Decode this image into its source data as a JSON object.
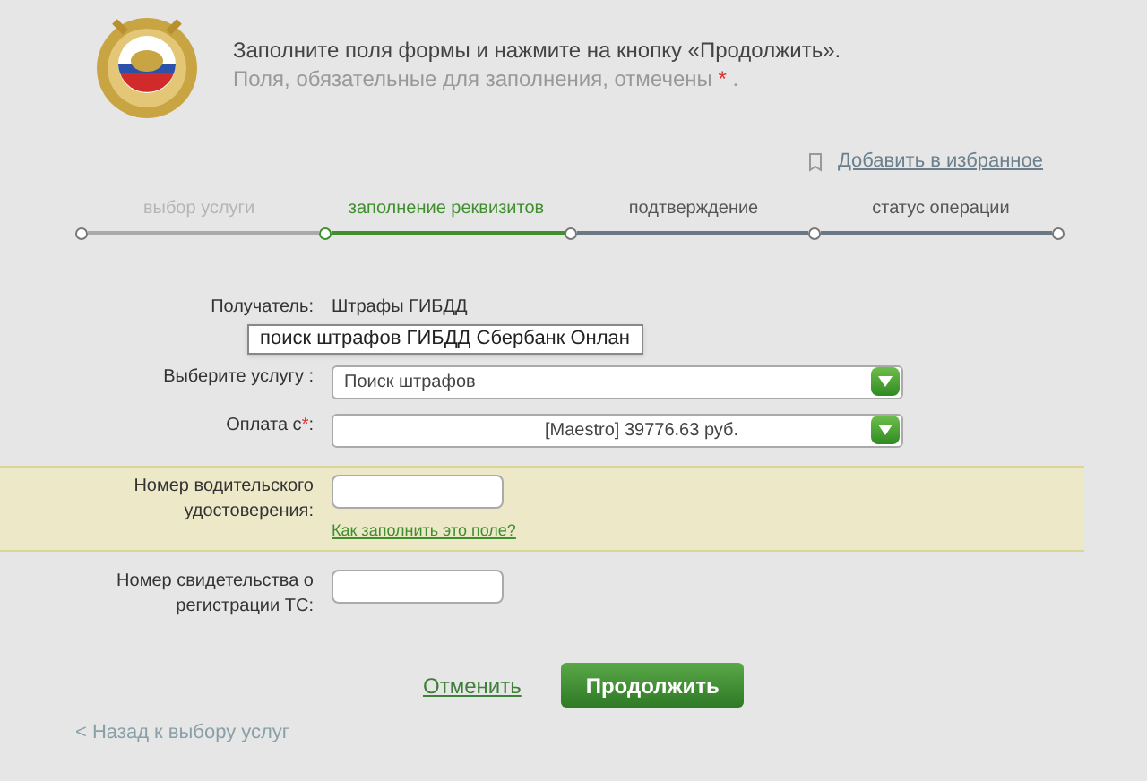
{
  "header": {
    "instruction": "Заполните поля формы и нажмите на кнопку «Продолжить».",
    "required_note": "Поля, обязательные для заполнения, отмечены",
    "required_mark": "*",
    "note_end": "."
  },
  "favorites_link": "Добавить в избранное",
  "steps": [
    {
      "label": "выбор услуги",
      "done": true,
      "selected": false
    },
    {
      "label": "заполнение реквизитов",
      "done": false,
      "selected": true
    },
    {
      "label": "подтверждение",
      "done": false,
      "selected": false
    },
    {
      "label": "статус операции",
      "done": false,
      "selected": false
    }
  ],
  "recipient": {
    "label": "Получатель:",
    "value": "Штрафы ГИБДД"
  },
  "tooltip": "поиск штрафов ГИБДД Сбербанк Онлан",
  "fields": [
    {
      "kind": "select",
      "label": "Выберите услугу :",
      "value": "Поиск штрафов",
      "highlighted": false
    },
    {
      "kind": "select",
      "label": "Оплата с",
      "required_mark": "*",
      "label_end": ":",
      "value": "[Maestro] 39776.63 руб.",
      "highlighted": false
    },
    {
      "kind": "text",
      "label": "Номер водительского удостоверения:",
      "help_link": "Как заполнить это поле?",
      "highlighted": true
    },
    {
      "kind": "text",
      "label": "Номер свидетельства о регистрации ТС:",
      "highlighted": false
    }
  ],
  "buttons": {
    "cancel": "Отменить",
    "continue": "Продолжить"
  },
  "back_link": "< Назад к выбору услуг"
}
